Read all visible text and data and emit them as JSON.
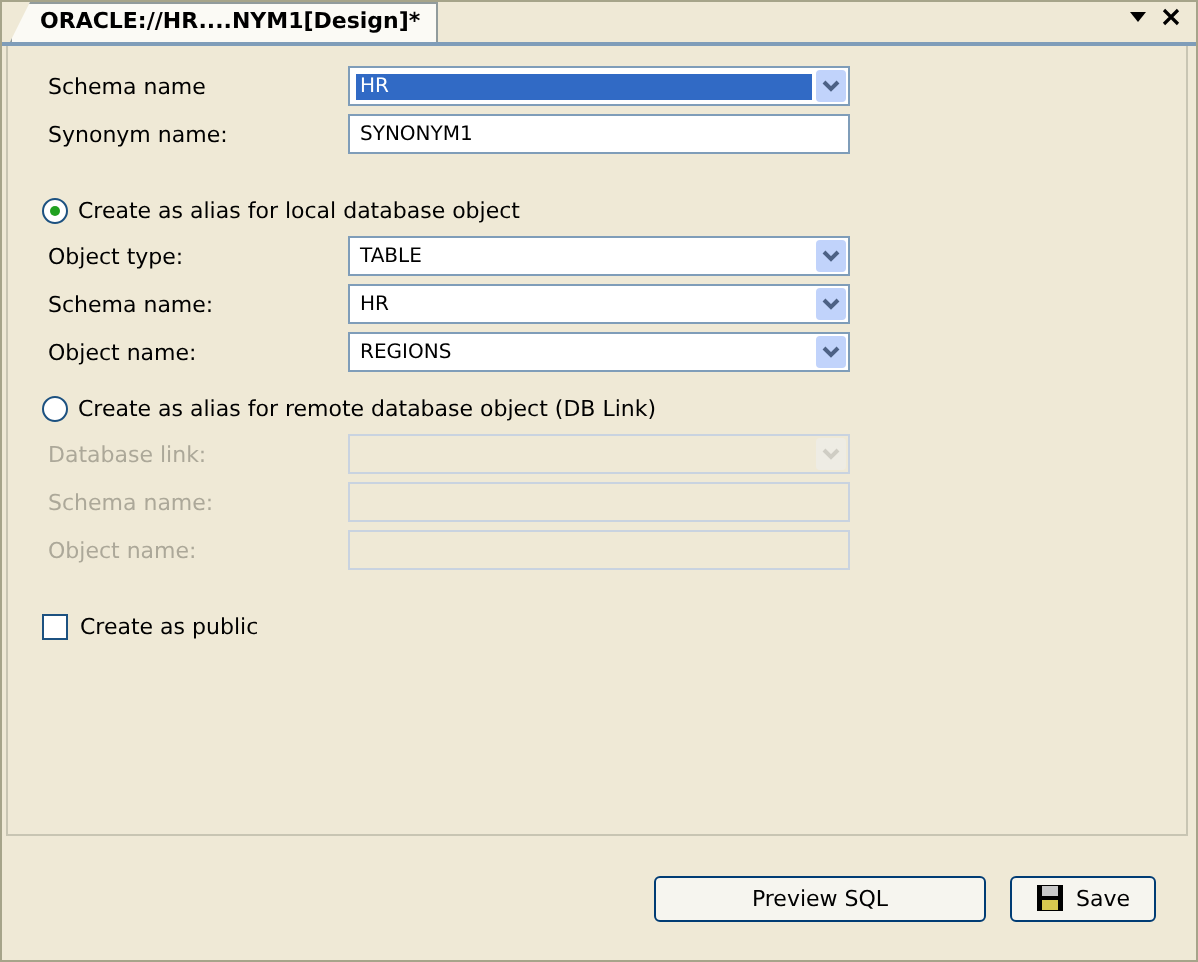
{
  "tab": {
    "label": "ORACLE://HR....NYM1[Design]*",
    "selected": true
  },
  "top_fields": [
    {
      "label": "Schema name",
      "kind": "select",
      "value": "HR",
      "highlighted": true,
      "disabled": false
    },
    {
      "label": "Synonym name:",
      "kind": "text",
      "value": "SYNONYM1",
      "highlighted": false,
      "disabled": false
    }
  ],
  "options": [
    {
      "label": "Create as alias for local database object",
      "selected": true,
      "fields": [
        {
          "label": "Object type:",
          "kind": "select",
          "value": "TABLE",
          "highlighted": false,
          "disabled": false
        },
        {
          "label": "Schema name:",
          "kind": "select",
          "value": "HR",
          "highlighted": false,
          "disabled": false
        },
        {
          "label": "Object name:",
          "kind": "select",
          "value": "REGIONS",
          "highlighted": false,
          "disabled": false
        }
      ]
    },
    {
      "label": "Create as alias for remote database object (DB Link)",
      "selected": false,
      "fields": [
        {
          "label": "Database link:",
          "kind": "select",
          "disabled": true,
          "highlighted": false
        },
        {
          "label": "Schema name:",
          "kind": "text",
          "disabled": true,
          "highlighted": false
        },
        {
          "label": "Object name:",
          "kind": "text",
          "disabled": true,
          "highlighted": false
        }
      ]
    }
  ],
  "public_checkbox": {
    "label": "Create as public",
    "checked": false
  },
  "buttons": [
    {
      "label": "Preview SQL",
      "kind": "plain"
    },
    {
      "label": "Save",
      "kind": "save"
    }
  ]
}
